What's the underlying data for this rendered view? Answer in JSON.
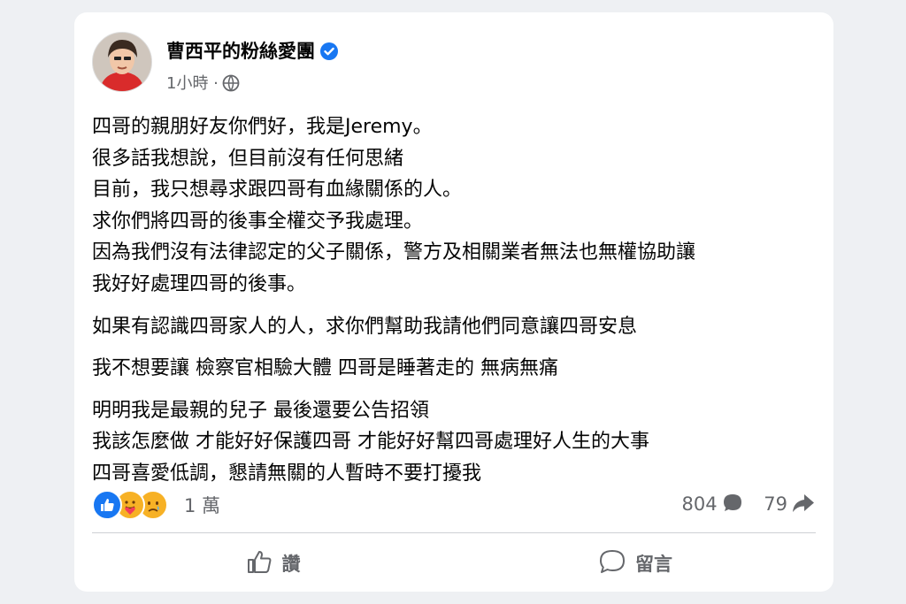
{
  "post": {
    "author": "曹西平的粉絲愛團",
    "time": "1小時 ·",
    "paragraphs": [
      [
        "四哥的親朋好友你們好，我是Jeremy。",
        "很多話我想說，但目前沒有任何思緒",
        "目前，我只想尋求跟四哥有血緣關係的人。",
        "求你們將四哥的後事全權交予我處理。",
        "因為我們沒有法律認定的父子關係，警方及相關業者無法也無權協助讓",
        "我好好處理四哥的後事。"
      ],
      [
        "如果有認識四哥家人的人，求你們幫助我請他們同意讓四哥安息"
      ],
      [
        "我不想要讓 檢察官相驗大體 四哥是睡著走的 無病無痛"
      ],
      [
        "明明我是最親的兒子 最後還要公告招領",
        "我該怎麼做 才能好好保護四哥 才能好好幫四哥處理好人生的大事",
        "四哥喜愛低調，懇請無關的人暫時不要打擾我"
      ]
    ]
  },
  "engagement": {
    "reactions_count": "1 萬",
    "comments_count": "804",
    "shares_count": "79"
  },
  "actions": {
    "like_label": "讚",
    "comment_label": "留言"
  },
  "icons": {
    "verified": "verified-badge-icon",
    "audience": "globe-icon",
    "like_reaction": "like-reaction-icon",
    "care_reaction": "care-reaction-icon",
    "sad_reaction": "sad-reaction-icon",
    "comment": "comment-bubble-icon",
    "share": "share-arrow-icon"
  },
  "colors": {
    "verified_blue": "#1877f2",
    "muted_text": "#65676b"
  }
}
